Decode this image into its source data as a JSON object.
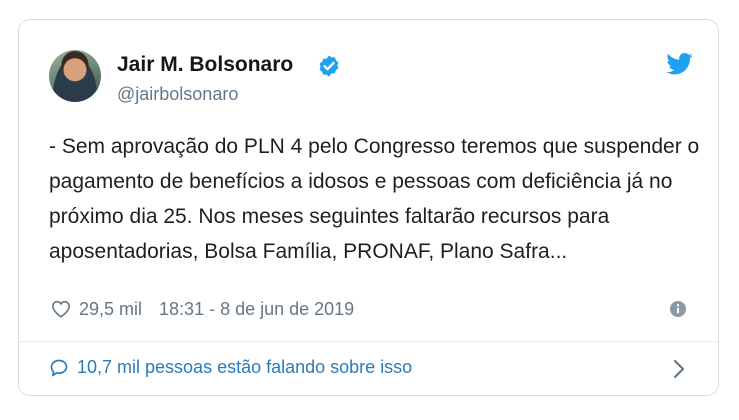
{
  "tweet": {
    "author_name": "Jair M. Bolsonaro",
    "handle": "@jairbolsonaro",
    "text": "- Sem aprovação do PLN 4 pelo Congresso teremos que suspender o pagamento de benefícios a idosos e pessoas com deficiência já no próximo dia 25. Nos meses seguintes faltarão recursos para aposentadorias, Bolsa Família, PRONAF, Plano Safra...",
    "likes": "29,5 mil",
    "timestamp": "18:31 - 8 de jun de 2019",
    "conversation": "10,7 mil pessoas estão falando sobre isso"
  },
  "icons": {
    "verified": "verified-badge-icon",
    "brand": "twitter-bird-icon",
    "like": "heart-icon",
    "info": "info-icon",
    "reply": "speech-bubble-icon",
    "more": "chevron-right-icon"
  },
  "colors": {
    "brand_blue": "#1da1f2",
    "link_blue": "#2b7bb9",
    "secondary_text": "#657786",
    "border": "#d7dde2"
  }
}
